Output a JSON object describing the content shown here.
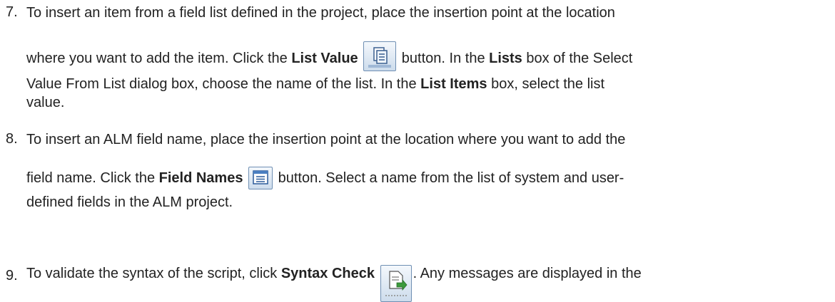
{
  "steps": [
    {
      "num": "7.",
      "l1": "To insert an item from a field list defined in the project, place the insertion point at the location",
      "l2a": "where you want to add the item. Click the ",
      "l2b": "List Value",
      "l2c": " button. In the ",
      "l2d": "Lists",
      "l2e": " box of the Select",
      "l3": "Value From List dialog box, choose the name of the list. In the ",
      "l3b": "List Items",
      "l3c": " box, select the list",
      "l4": "value.",
      "icon": "list-value-icon"
    },
    {
      "num": "8.",
      "l1": "To insert an ALM field name, place the insertion point at the location where you want to add the",
      "l2a": "field name. Click the ",
      "l2b": "Field Names",
      "l2c": " button. Select a name from the list of system and user-",
      "l3": "defined fields in the ALM project.",
      "icon": "field-names-icon"
    },
    {
      "num": "9.",
      "l1a": "To validate the syntax of the script, click ",
      "l1b": "Syntax Check",
      "l1c": ". Any messages are displayed in the",
      "icon": "syntax-check-icon"
    }
  ]
}
